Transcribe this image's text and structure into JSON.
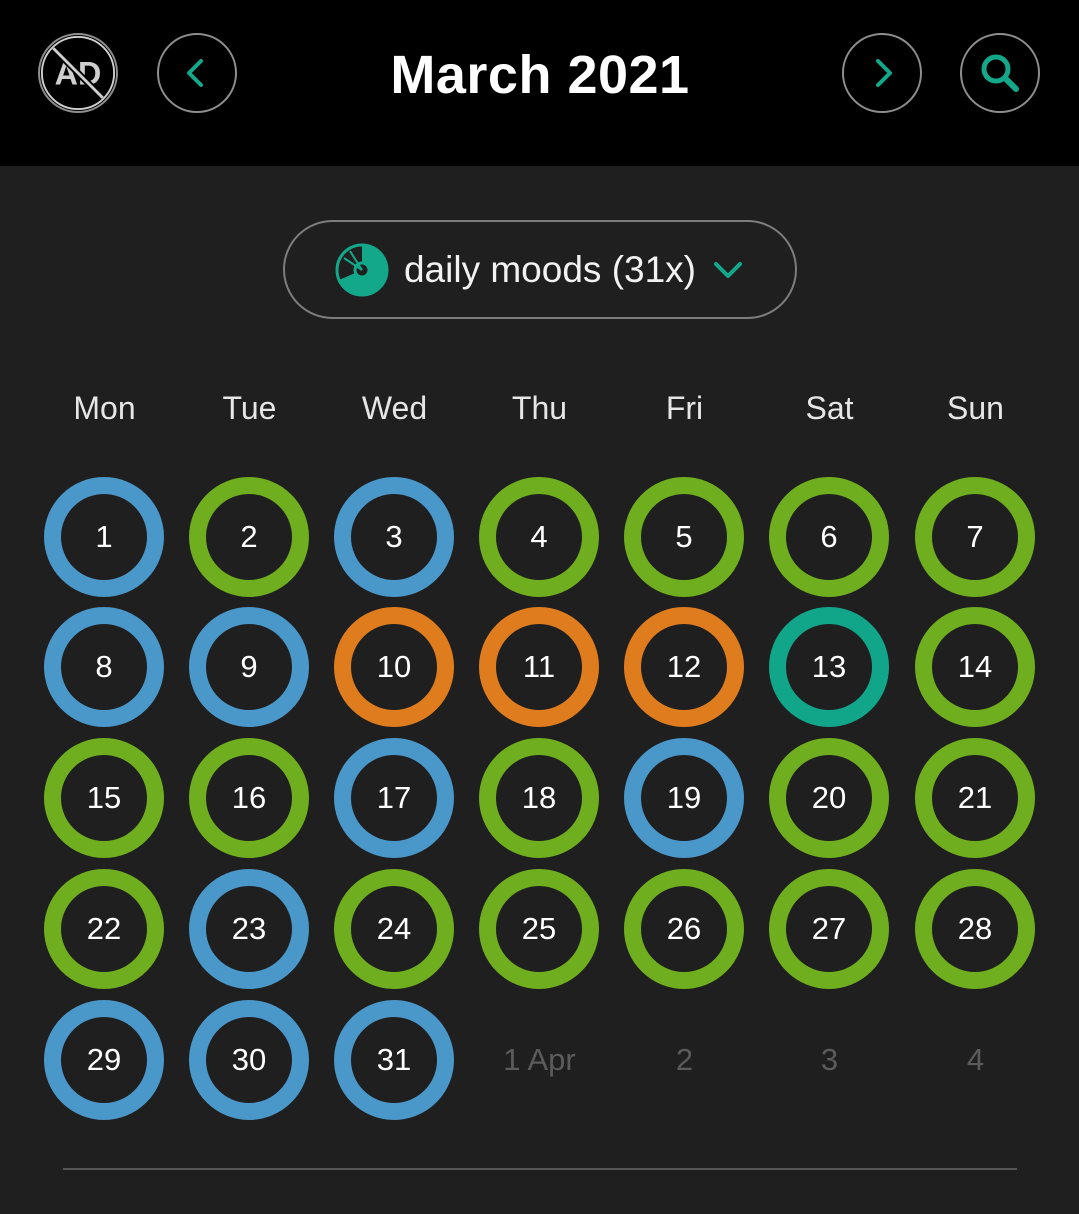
{
  "header": {
    "title": "March 2021",
    "no_ads_icon_text": "AD"
  },
  "filter": {
    "label": "daily moods (31x)"
  },
  "weekdays": [
    "Mon",
    "Tue",
    "Wed",
    "Thu",
    "Fri",
    "Sat",
    "Sun"
  ],
  "colors": {
    "blue": "#4a97c9",
    "green": "#6fae1e",
    "orange": "#df7d1e",
    "teal": "#11a58a",
    "accent": "#14a88a"
  },
  "days": [
    {
      "label": "1",
      "mood": "blue"
    },
    {
      "label": "2",
      "mood": "green"
    },
    {
      "label": "3",
      "mood": "blue"
    },
    {
      "label": "4",
      "mood": "green"
    },
    {
      "label": "5",
      "mood": "green"
    },
    {
      "label": "6",
      "mood": "green"
    },
    {
      "label": "7",
      "mood": "green"
    },
    {
      "label": "8",
      "mood": "blue"
    },
    {
      "label": "9",
      "mood": "blue"
    },
    {
      "label": "10",
      "mood": "orange"
    },
    {
      "label": "11",
      "mood": "orange"
    },
    {
      "label": "12",
      "mood": "orange"
    },
    {
      "label": "13",
      "mood": "teal"
    },
    {
      "label": "14",
      "mood": "green"
    },
    {
      "label": "15",
      "mood": "green"
    },
    {
      "label": "16",
      "mood": "green"
    },
    {
      "label": "17",
      "mood": "blue"
    },
    {
      "label": "18",
      "mood": "green"
    },
    {
      "label": "19",
      "mood": "blue"
    },
    {
      "label": "20",
      "mood": "green"
    },
    {
      "label": "21",
      "mood": "green"
    },
    {
      "label": "22",
      "mood": "green"
    },
    {
      "label": "23",
      "mood": "blue"
    },
    {
      "label": "24",
      "mood": "green"
    },
    {
      "label": "25",
      "mood": "green"
    },
    {
      "label": "26",
      "mood": "green"
    },
    {
      "label": "27",
      "mood": "green"
    },
    {
      "label": "28",
      "mood": "green"
    },
    {
      "label": "29",
      "mood": "blue"
    },
    {
      "label": "30",
      "mood": "blue"
    },
    {
      "label": "31",
      "mood": "blue"
    }
  ],
  "next_month_days": [
    "1 Apr",
    "2",
    "3",
    "4"
  ]
}
